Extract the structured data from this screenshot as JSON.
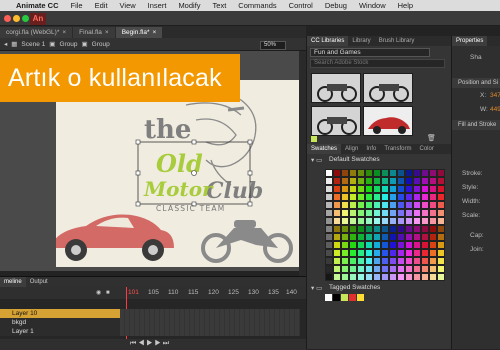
{
  "menubar": {
    "app": "Animate CC",
    "items": [
      "File",
      "Edit",
      "View",
      "Insert",
      "Modify",
      "Text",
      "Commands",
      "Control",
      "Debug",
      "Window",
      "Help"
    ]
  },
  "appbar": {
    "logo": "An"
  },
  "doc_tabs": [
    {
      "label": "corgi.fla (WebGL)*",
      "close": "×"
    },
    {
      "label": "Final.fla",
      "close": "×"
    },
    {
      "label": "Begin.fla*",
      "close": "×"
    }
  ],
  "editbar": {
    "scene": "Scene 1",
    "crumb1": "Group",
    "crumb2": "Group",
    "zoom": "50%"
  },
  "banner": {
    "text": "Artık o kullanılacak"
  },
  "artwork": {
    "the": "the",
    "old": "Old",
    "motor": "Motor",
    "club": "Club",
    "tagline": "CLASSIC TEAM"
  },
  "timeline": {
    "tabs": [
      "meline",
      "Output"
    ],
    "frame_numbers": [
      "101",
      "105",
      "110",
      "115",
      "120",
      "125",
      "130",
      "135",
      "140",
      "145"
    ],
    "current_frame": "101",
    "layers": [
      "Layer 10",
      "bkgd",
      "Layer 1"
    ]
  },
  "cclib": {
    "tabs": [
      "CC Libraries",
      "Library",
      "Brush Library"
    ],
    "library": "Fun and Games",
    "search_placeholder": "Search Adobe Stock"
  },
  "swatches": {
    "tabs": [
      "Swatches",
      "Align",
      "Info",
      "Transform",
      "Color"
    ],
    "default_label": "Default Swatches",
    "tagged_label": "Tagged Swatches"
  },
  "props": {
    "tab": "Properties",
    "shape_label": "Sha",
    "pos_section": "Position and Si",
    "x_label": "X:",
    "x_val": "347",
    "y_label": "W:",
    "y_val": "449",
    "fill_section": "Fill and Stroke",
    "stroke_label": "Stroke:",
    "style_label": "Style:",
    "width_label": "Width:",
    "scale_label": "Scale:",
    "cap_label": "Cap:",
    "join_label": "Join:"
  },
  "colors": {
    "banner": "#f39800",
    "accent": "#e08a2a",
    "selected_layer": "#d6a234"
  }
}
